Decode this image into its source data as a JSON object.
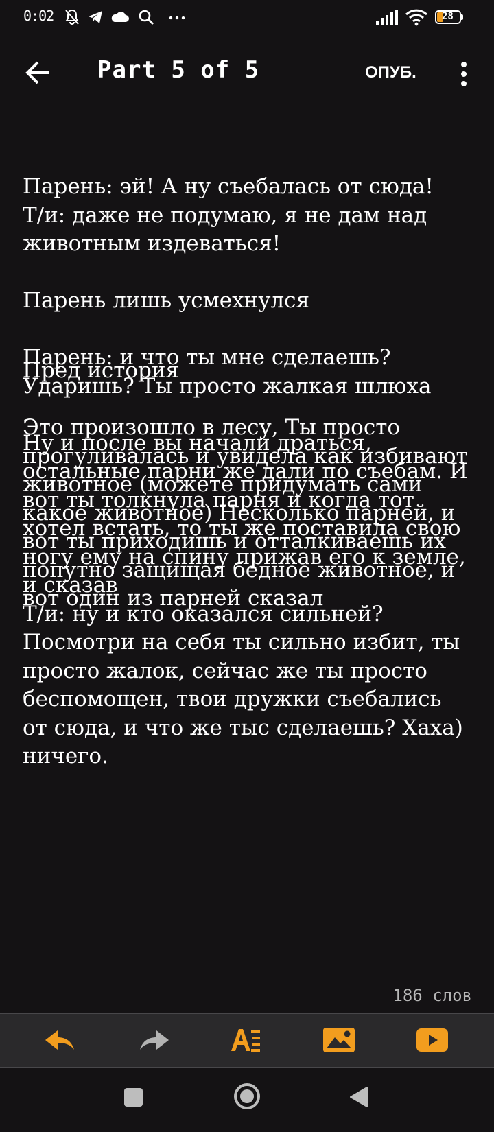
{
  "status_bar": {
    "time": "0:02",
    "battery_level": "28"
  },
  "app_bar": {
    "title": "Part 5 of 5",
    "publish_label": "ОПУБ."
  },
  "story": {
    "layer_top": "Парень: эй! А ну съебалась от сюда!\nТ/и: даже не подумаю, я не дам над животным издеваться!\n\nПарень лишь усмехнулся\n\nПарень: и что ты мне сделаешь? Ударишь? Ты просто жалкая шлюха\n\nНу и после вы начали драться, остальные парни же дали по съебам. И вот ты толкнула парня и когда тот хотел встать, то ты же поставила свою ногу ему на спину прижав его к земле, и сказав\nТ/и: ну и кто оказался сильней? Посмотри на себя ты сильно избит, ты просто жалок, сейчас же ты просто беспомощен, твои дружки съебались  от сюда, и что же тыс сделаешь? Хаха) ничего.",
    "layer_bottom": "Пред история\n\nЭто произошло в лесу, Ты просто прогуливалась и увидела как избивают животное (можете придумать сами какое животное) Несколько парней, и вот ты приходишь и отталкиваешь их попутно защищая бедное животное, и вот один из парней сказал"
  },
  "word_count": "186 слов",
  "toolbar": {
    "accent": "#f29d1e",
    "icons": [
      "undo-icon",
      "redo-icon",
      "text-format-icon",
      "image-icon",
      "video-icon"
    ]
  },
  "nav_bar": {
    "icons": [
      "recents-square-icon",
      "home-circle-icon",
      "back-triangle-icon"
    ]
  }
}
